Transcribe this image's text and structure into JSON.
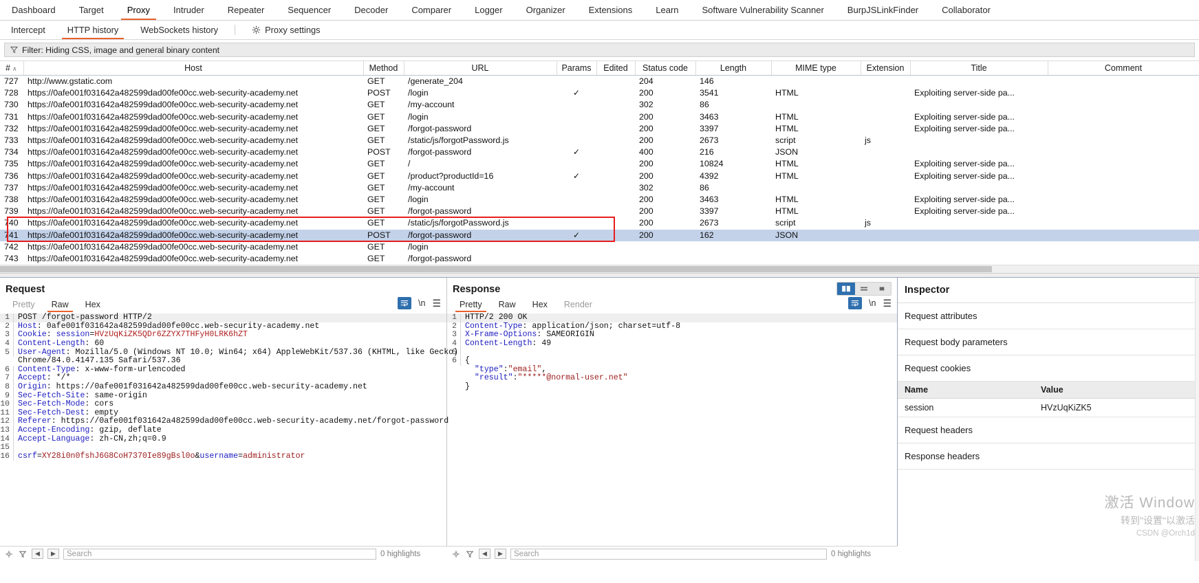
{
  "main_tabs": [
    {
      "label": "Dashboard",
      "active": false
    },
    {
      "label": "Target",
      "active": false
    },
    {
      "label": "Proxy",
      "active": true
    },
    {
      "label": "Intruder",
      "active": false
    },
    {
      "label": "Repeater",
      "active": false
    },
    {
      "label": "Sequencer",
      "active": false
    },
    {
      "label": "Decoder",
      "active": false
    },
    {
      "label": "Comparer",
      "active": false
    },
    {
      "label": "Logger",
      "active": false
    },
    {
      "label": "Organizer",
      "active": false
    },
    {
      "label": "Extensions",
      "active": false
    },
    {
      "label": "Learn",
      "active": false
    },
    {
      "label": "Software Vulnerability Scanner",
      "active": false
    },
    {
      "label": "BurpJSLinkFinder",
      "active": false
    },
    {
      "label": "Collaborator",
      "active": false
    }
  ],
  "sub_tabs": [
    {
      "label": "Intercept",
      "active": false
    },
    {
      "label": "HTTP history",
      "active": true
    },
    {
      "label": "WebSockets history",
      "active": false
    }
  ],
  "proxy_settings_label": "Proxy settings",
  "filter": {
    "icon": "filter-icon",
    "text": "Filter: Hiding CSS, image and general binary content"
  },
  "table": {
    "columns": [
      "#",
      "Host",
      "Method",
      "URL",
      "Params",
      "Edited",
      "Status code",
      "Length",
      "MIME type",
      "Extension",
      "Title",
      "Comment"
    ],
    "sort_column": "#",
    "sort_direction": "asc",
    "rows": [
      {
        "num": "727",
        "host": "http://www.gstatic.com",
        "method": "GET",
        "url": "/generate_204",
        "params": "",
        "edited": "",
        "status": "204",
        "length": "146",
        "mime": "",
        "ext": "",
        "title": "",
        "comment": "",
        "selected": false
      },
      {
        "num": "728",
        "host": "https://0afe001f031642a482599dad00fe00cc.web-security-academy.net",
        "method": "POST",
        "url": "/login",
        "params": "✓",
        "edited": "",
        "status": "200",
        "length": "3541",
        "mime": "HTML",
        "ext": "",
        "title": "Exploiting server-side pa...",
        "comment": "",
        "selected": false
      },
      {
        "num": "730",
        "host": "https://0afe001f031642a482599dad00fe00cc.web-security-academy.net",
        "method": "GET",
        "url": "/my-account",
        "params": "",
        "edited": "",
        "status": "302",
        "length": "86",
        "mime": "",
        "ext": "",
        "title": "",
        "comment": "",
        "selected": false
      },
      {
        "num": "731",
        "host": "https://0afe001f031642a482599dad00fe00cc.web-security-academy.net",
        "method": "GET",
        "url": "/login",
        "params": "",
        "edited": "",
        "status": "200",
        "length": "3463",
        "mime": "HTML",
        "ext": "",
        "title": "Exploiting server-side pa...",
        "comment": "",
        "selected": false
      },
      {
        "num": "732",
        "host": "https://0afe001f031642a482599dad00fe00cc.web-security-academy.net",
        "method": "GET",
        "url": "/forgot-password",
        "params": "",
        "edited": "",
        "status": "200",
        "length": "3397",
        "mime": "HTML",
        "ext": "",
        "title": "Exploiting server-side pa...",
        "comment": "",
        "selected": false
      },
      {
        "num": "733",
        "host": "https://0afe001f031642a482599dad00fe00cc.web-security-academy.net",
        "method": "GET",
        "url": "/static/js/forgotPassword.js",
        "params": "",
        "edited": "",
        "status": "200",
        "length": "2673",
        "mime": "script",
        "ext": "js",
        "title": "",
        "comment": "",
        "selected": false
      },
      {
        "num": "734",
        "host": "https://0afe001f031642a482599dad00fe00cc.web-security-academy.net",
        "method": "POST",
        "url": "/forgot-password",
        "params": "✓",
        "edited": "",
        "status": "400",
        "length": "216",
        "mime": "JSON",
        "ext": "",
        "title": "",
        "comment": "",
        "selected": false
      },
      {
        "num": "735",
        "host": "https://0afe001f031642a482599dad00fe00cc.web-security-academy.net",
        "method": "GET",
        "url": "/",
        "params": "",
        "edited": "",
        "status": "200",
        "length": "10824",
        "mime": "HTML",
        "ext": "",
        "title": "Exploiting server-side pa...",
        "comment": "",
        "selected": false
      },
      {
        "num": "736",
        "host": "https://0afe001f031642a482599dad00fe00cc.web-security-academy.net",
        "method": "GET",
        "url": "/product?productId=16",
        "params": "✓",
        "edited": "",
        "status": "200",
        "length": "4392",
        "mime": "HTML",
        "ext": "",
        "title": "Exploiting server-side pa...",
        "comment": "",
        "selected": false
      },
      {
        "num": "737",
        "host": "https://0afe001f031642a482599dad00fe00cc.web-security-academy.net",
        "method": "GET",
        "url": "/my-account",
        "params": "",
        "edited": "",
        "status": "302",
        "length": "86",
        "mime": "",
        "ext": "",
        "title": "",
        "comment": "",
        "selected": false
      },
      {
        "num": "738",
        "host": "https://0afe001f031642a482599dad00fe00cc.web-security-academy.net",
        "method": "GET",
        "url": "/login",
        "params": "",
        "edited": "",
        "status": "200",
        "length": "3463",
        "mime": "HTML",
        "ext": "",
        "title": "Exploiting server-side pa...",
        "comment": "",
        "selected": false
      },
      {
        "num": "739",
        "host": "https://0afe001f031642a482599dad00fe00cc.web-security-academy.net",
        "method": "GET",
        "url": "/forgot-password",
        "params": "",
        "edited": "",
        "status": "200",
        "length": "3397",
        "mime": "HTML",
        "ext": "",
        "title": "Exploiting server-side pa...",
        "comment": "",
        "selected": false
      },
      {
        "num": "740",
        "host": "https://0afe001f031642a482599dad00fe00cc.web-security-academy.net",
        "method": "GET",
        "url": "/static/js/forgotPassword.js",
        "params": "",
        "edited": "",
        "status": "200",
        "length": "2673",
        "mime": "script",
        "ext": "js",
        "title": "",
        "comment": "",
        "selected": false
      },
      {
        "num": "741",
        "host": "https://0afe001f031642a482599dad00fe00cc.web-security-academy.net",
        "method": "POST",
        "url": "/forgot-password",
        "params": "✓",
        "edited": "",
        "status": "200",
        "length": "162",
        "mime": "JSON",
        "ext": "",
        "title": "",
        "comment": "",
        "selected": true
      },
      {
        "num": "742",
        "host": "https://0afe001f031642a482599dad00fe00cc.web-security-academy.net",
        "method": "GET",
        "url": "/login",
        "params": "",
        "edited": "",
        "status": "",
        "length": "",
        "mime": "",
        "ext": "",
        "title": "",
        "comment": "",
        "selected": false
      },
      {
        "num": "743",
        "host": "https://0afe001f031642a482599dad00fe00cc.web-security-academy.net",
        "method": "GET",
        "url": "/forgot-password",
        "params": "",
        "edited": "",
        "status": "",
        "length": "",
        "mime": "",
        "ext": "",
        "title": "",
        "comment": "",
        "selected": false
      }
    ]
  },
  "request": {
    "title": "Request",
    "tabs": [
      {
        "label": "Pretty",
        "active": false,
        "dim": true
      },
      {
        "label": "Raw",
        "active": true,
        "dim": false
      },
      {
        "label": "Hex",
        "active": false,
        "dim": false
      }
    ],
    "lines": [
      {
        "n": "1",
        "segments": [
          {
            "t": "POST /forgot-password HTTP/2",
            "c": "k-val"
          }
        ],
        "hl": true
      },
      {
        "n": "2",
        "segments": [
          {
            "t": "Host",
            "c": "k-hdr"
          },
          {
            "t": ": 0afe001f031642a482599dad00fe00cc.web-security-academy.net",
            "c": "k-val"
          }
        ]
      },
      {
        "n": "3",
        "segments": [
          {
            "t": "Cookie",
            "c": "k-hdr"
          },
          {
            "t": ": ",
            "c": "k-val"
          },
          {
            "t": "session",
            "c": "k-str"
          },
          {
            "t": "=",
            "c": "k-val"
          },
          {
            "t": "HVzUqKiZK5QDr6ZZYX7THFyH0LRK6hZT",
            "c": "k-red"
          }
        ]
      },
      {
        "n": "4",
        "segments": [
          {
            "t": "Content-Length",
            "c": "k-hdr"
          },
          {
            "t": ": 60",
            "c": "k-val"
          }
        ]
      },
      {
        "n": "5",
        "segments": [
          {
            "t": "User-Agent",
            "c": "k-hdr"
          },
          {
            "t": ": Mozilla/5.0 (Windows NT 10.0; Win64; x64) AppleWebKit/537.36 (KHTML, like Gecko)",
            "c": "k-val"
          }
        ]
      },
      {
        "n": "",
        "segments": [
          {
            "t": "Chrome/84.0.4147.135 Safari/537.36",
            "c": "k-val"
          }
        ]
      },
      {
        "n": "6",
        "segments": [
          {
            "t": "Content-Type",
            "c": "k-hdr"
          },
          {
            "t": ": x-www-form-urlencoded",
            "c": "k-val"
          }
        ]
      },
      {
        "n": "7",
        "segments": [
          {
            "t": "Accept",
            "c": "k-hdr"
          },
          {
            "t": ": */*",
            "c": "k-val"
          }
        ]
      },
      {
        "n": "8",
        "segments": [
          {
            "t": "Origin",
            "c": "k-hdr"
          },
          {
            "t": ": https://0afe001f031642a482599dad00fe00cc.web-security-academy.net",
            "c": "k-val"
          }
        ]
      },
      {
        "n": "9",
        "segments": [
          {
            "t": "Sec-Fetch-Site",
            "c": "k-hdr"
          },
          {
            "t": ": same-origin",
            "c": "k-val"
          }
        ]
      },
      {
        "n": "10",
        "segments": [
          {
            "t": "Sec-Fetch-Mode",
            "c": "k-hdr"
          },
          {
            "t": ": cors",
            "c": "k-val"
          }
        ]
      },
      {
        "n": "11",
        "segments": [
          {
            "t": "Sec-Fetch-Dest",
            "c": "k-hdr"
          },
          {
            "t": ": empty",
            "c": "k-val"
          }
        ]
      },
      {
        "n": "12",
        "segments": [
          {
            "t": "Referer",
            "c": "k-hdr"
          },
          {
            "t": ": https://0afe001f031642a482599dad00fe00cc.web-security-academy.net/forgot-password",
            "c": "k-val"
          }
        ]
      },
      {
        "n": "13",
        "segments": [
          {
            "t": "Accept-Encoding",
            "c": "k-hdr"
          },
          {
            "t": ": gzip, deflate",
            "c": "k-val"
          }
        ]
      },
      {
        "n": "14",
        "segments": [
          {
            "t": "Accept-Language",
            "c": "k-hdr"
          },
          {
            "t": ": zh-CN,zh;q=0.9",
            "c": "k-val"
          }
        ]
      },
      {
        "n": "15",
        "segments": [
          {
            "t": "",
            "c": "k-val"
          }
        ]
      },
      {
        "n": "16",
        "segments": [
          {
            "t": "csrf",
            "c": "k-str"
          },
          {
            "t": "=",
            "c": "k-val"
          },
          {
            "t": "XY28i0n0fshJ6G8CoH7370Ie89gBsl0o",
            "c": "k-dred"
          },
          {
            "t": "&",
            "c": "k-val"
          },
          {
            "t": "username",
            "c": "k-str"
          },
          {
            "t": "=",
            "c": "k-val"
          },
          {
            "t": "administrator",
            "c": "k-dred"
          }
        ]
      }
    ],
    "search_placeholder": "Search",
    "matches_label": "0 highlights"
  },
  "response": {
    "title": "Response",
    "tabs": [
      {
        "label": "Pretty",
        "active": true,
        "dim": false
      },
      {
        "label": "Raw",
        "active": false,
        "dim": false
      },
      {
        "label": "Hex",
        "active": false,
        "dim": false
      },
      {
        "label": "Render",
        "active": false,
        "dim": true
      }
    ],
    "lines": [
      {
        "n": "1",
        "segments": [
          {
            "t": "HTTP/2 200 OK",
            "c": "k-val"
          }
        ],
        "hl": true
      },
      {
        "n": "2",
        "segments": [
          {
            "t": "Content-Type",
            "c": "k-hdr"
          },
          {
            "t": ": application/json; charset=utf-8",
            "c": "k-val"
          }
        ]
      },
      {
        "n": "3",
        "segments": [
          {
            "t": "X-Frame-Options",
            "c": "k-hdr"
          },
          {
            "t": ": SAMEORIGIN",
            "c": "k-val"
          }
        ]
      },
      {
        "n": "4",
        "segments": [
          {
            "t": "Content-Length",
            "c": "k-hdr"
          },
          {
            "t": ": 49",
            "c": "k-val"
          }
        ]
      },
      {
        "n": "5",
        "segments": [
          {
            "t": "",
            "c": "k-val"
          }
        ]
      },
      {
        "n": "6",
        "segments": [
          {
            "t": "{",
            "c": "k-val"
          }
        ]
      },
      {
        "n": "",
        "segments": [
          {
            "t": "  \"type\"",
            "c": "k-str"
          },
          {
            "t": ":",
            "c": "k-val"
          },
          {
            "t": "\"email\"",
            "c": "k-dred"
          },
          {
            "t": ",",
            "c": "k-val"
          }
        ]
      },
      {
        "n": "",
        "segments": [
          {
            "t": "  \"result\"",
            "c": "k-str"
          },
          {
            "t": ":",
            "c": "k-val"
          },
          {
            "t": "\"*****@normal-user.net\"",
            "c": "k-dred"
          }
        ]
      },
      {
        "n": "",
        "segments": [
          {
            "t": "}",
            "c": "k-val"
          }
        ]
      }
    ],
    "search_placeholder": "Search",
    "matches_label": "0 highlights"
  },
  "inspector": {
    "title": "Inspector",
    "sections": [
      {
        "label": "Request attributes"
      },
      {
        "label": "Request body parameters"
      },
      {
        "label": "Request cookies"
      }
    ],
    "cookies_table": {
      "headers": [
        "Name",
        "Value"
      ],
      "rows": [
        {
          "name": "session",
          "value": "HVzUqKiZK5"
        }
      ]
    },
    "footer_sections": [
      {
        "label": "Request headers"
      },
      {
        "label": "Response headers"
      }
    ]
  },
  "watermark": {
    "line1": "激活 Window",
    "line2": "转到\"设置\"以激活",
    "line3": "CSDN @Orch1d"
  },
  "colors": {
    "accent_orange": "#e8622c",
    "selection_blue": "#c3d2e9",
    "highlight_red": "#e81c1c",
    "button_blue": "#2e6fae"
  }
}
